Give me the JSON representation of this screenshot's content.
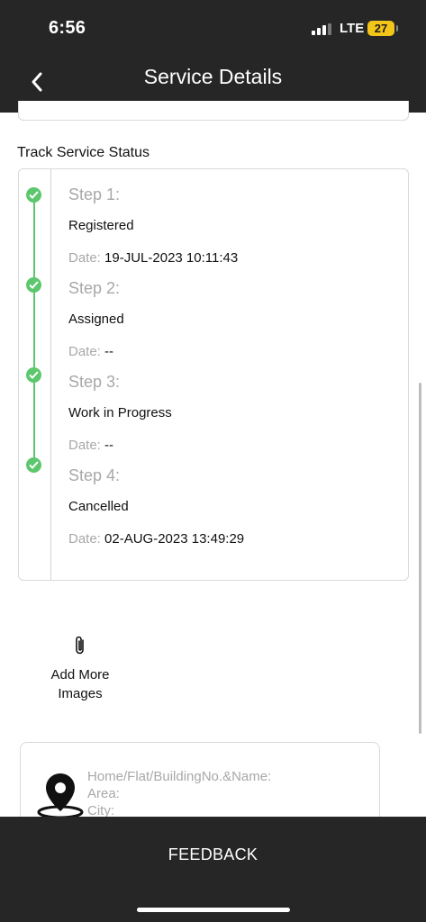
{
  "status_bar": {
    "time": "6:56",
    "network": "LTE",
    "battery": "27"
  },
  "header": {
    "title": "Service Details",
    "back_icon": "chevron-left-icon"
  },
  "track": {
    "section_title": "Track Service Status",
    "accent_color": "#5cc76d",
    "date_key": "Date:",
    "steps": [
      {
        "label": "Step 1:",
        "status": "Registered",
        "date": "19-JUL-2023 10:11:43"
      },
      {
        "label": "Step 2:",
        "status": "Assigned",
        "date": "--"
      },
      {
        "label": "Step 3:",
        "status": "Work in Progress",
        "date": "--"
      },
      {
        "label": "Step 4:",
        "status": "Cancelled",
        "date": "02-AUG-2023 13:49:29"
      }
    ]
  },
  "attachments": {
    "icon": "paperclip-icon",
    "label_line1": "Add More",
    "label_line2": "Images"
  },
  "address": {
    "icon": "location-pin-icon",
    "line1": "Home/Flat/BuildingNo.&Name:",
    "line2": "Area:",
    "line3": "City:"
  },
  "footer": {
    "feedback_label": "FEEDBACK"
  }
}
